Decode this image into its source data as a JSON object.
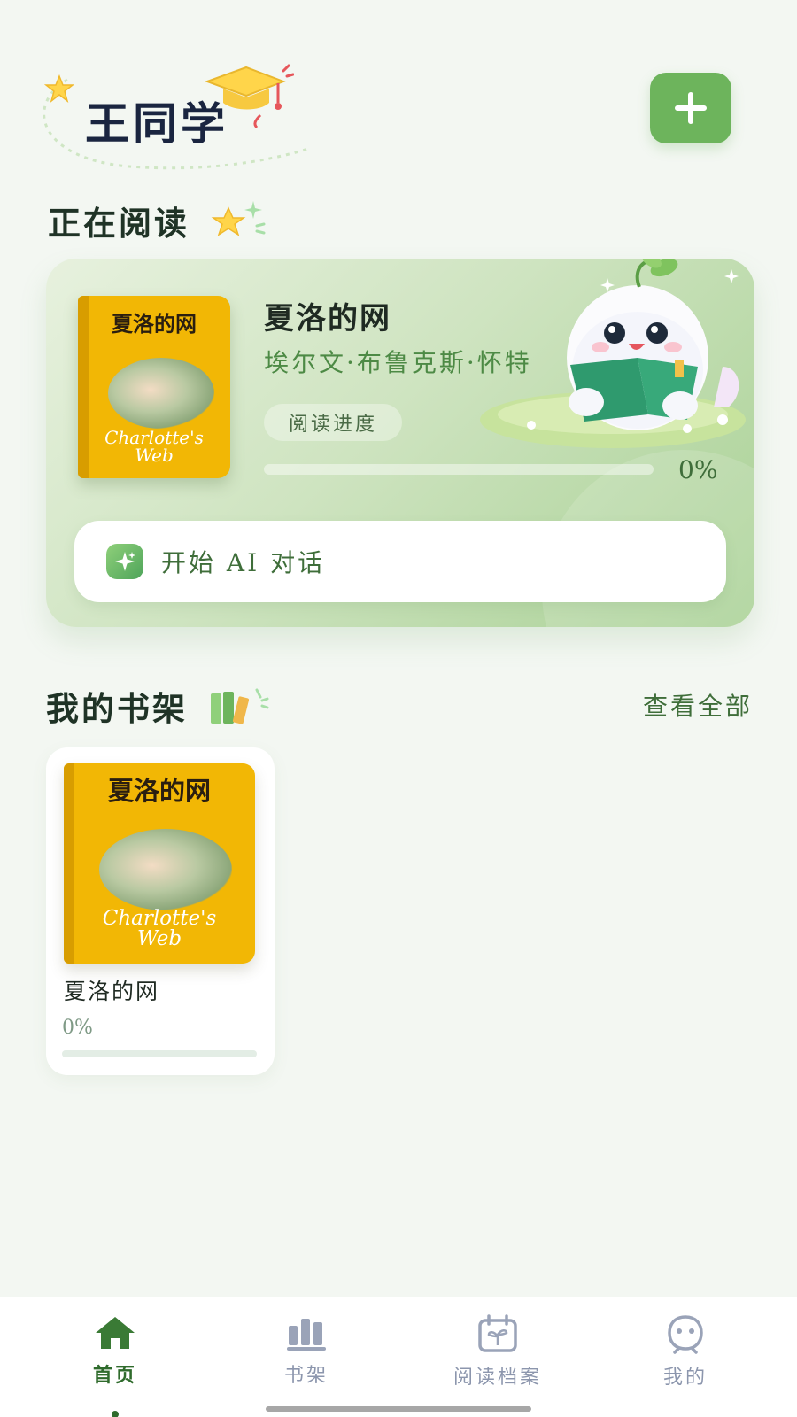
{
  "header": {
    "user_name": "王同学"
  },
  "reading": {
    "section_title": "正在阅读",
    "book": {
      "title": "夏洛的网",
      "author": "埃尔文·布鲁克斯·怀特",
      "cover_title": "夏洛的网",
      "cover_en_line1": "Charlotte's",
      "cover_en_line2": "Web",
      "progress_label": "阅读进度",
      "progress_value": "0%",
      "progress_fraction": 0
    },
    "ai_button_label": "开始 AI 对话"
  },
  "shelf": {
    "section_title": "我的书架",
    "view_all_label": "查看全部",
    "books": [
      {
        "title": "夏洛的网",
        "cover_title": "夏洛的网",
        "cover_en_line1": "Charlotte's",
        "cover_en_line2": "Web",
        "progress_value": "0%",
        "progress_fraction": 0
      }
    ]
  },
  "nav": {
    "items": [
      {
        "label": "首页",
        "icon": "home-icon",
        "active": true
      },
      {
        "label": "书架",
        "icon": "bookshelf-icon",
        "active": false
      },
      {
        "label": "阅读档案",
        "icon": "calendar-sprout-icon",
        "active": false
      },
      {
        "label": "我的",
        "icon": "profile-icon",
        "active": false
      }
    ]
  },
  "colors": {
    "accent": "#6db45c",
    "accent_dark": "#2f6b2c",
    "nav_inactive": "#8c96ad",
    "background": "#f3f7f2"
  }
}
